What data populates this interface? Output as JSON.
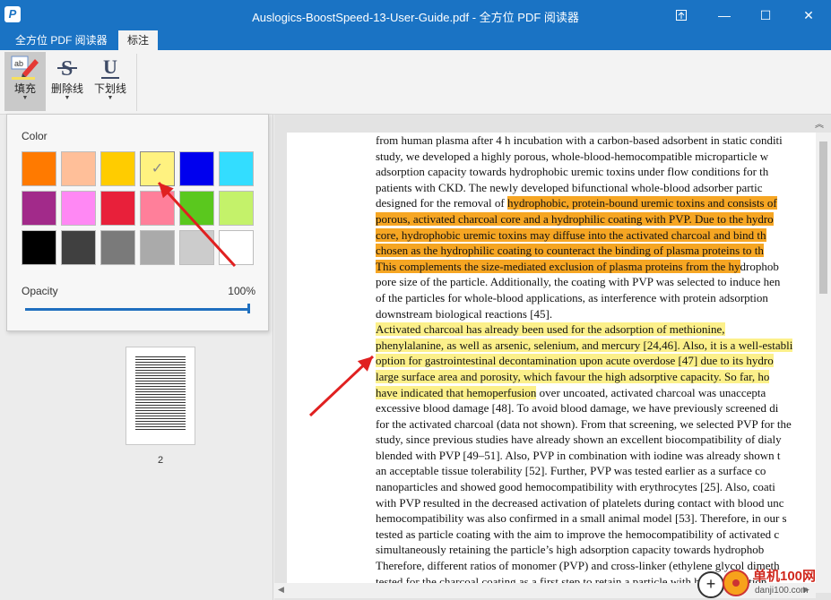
{
  "window": {
    "title": "Auslogics-BoostSpeed-13-User-Guide.pdf - 全方位 PDF 阅读器",
    "app_icon_glyph": "P",
    "controls": {
      "restore_down_icon": "restore-icon",
      "minimize": "—",
      "maximize": "☐",
      "close": "✕"
    }
  },
  "tabs": [
    {
      "label": "全方位 PDF 阅读器",
      "active": false
    },
    {
      "label": "标注",
      "active": true
    }
  ],
  "ribbon": {
    "buttons": [
      {
        "label": "填充",
        "icon": "highlight-fill-icon",
        "active": true
      },
      {
        "label": "删除线",
        "icon": "strikethrough-icon",
        "active": false
      },
      {
        "label": "下划线",
        "icon": "underline-icon",
        "active": false
      }
    ]
  },
  "color_popup": {
    "title": "Color",
    "swatches": [
      [
        "#ff7a00",
        "#ffbf99",
        "#ffcc00",
        "#fff280",
        "#0000ee",
        "#33ddff"
      ],
      [
        "#a22a8a",
        "#ff88f4",
        "#e8203a",
        "#ff7f9a",
        "#5ac81e",
        "#c4f26a"
      ],
      [
        "#000000",
        "#404040",
        "#7a7a7a",
        "#aaaaaa",
        "#cccccc",
        "#ffffff"
      ]
    ],
    "selected": {
      "row": 0,
      "col": 3
    },
    "check_glyph": "✓",
    "opacity_label": "Opacity",
    "opacity_value": "100%",
    "opacity_fraction": 1.0
  },
  "thumbnail": {
    "page_number": "2"
  },
  "document": {
    "lines": [
      {
        "segments": [
          [
            "from human plasma after 4 h incubation with a carbon-based adsorbent in static conditi",
            ""
          ]
        ]
      },
      {
        "segments": [
          [
            "study, we developed a highly porous, whole-blood-hemocompatible microparticle w",
            ""
          ]
        ]
      },
      {
        "segments": [
          [
            "adsorption capacity towards hydrophobic uremic toxins under flow conditions for th",
            ""
          ]
        ]
      },
      {
        "segments": [
          [
            "patients with CKD. The newly developed bifunctional whole-blood adsorber partic",
            ""
          ]
        ]
      },
      {
        "segments": [
          [
            "designed for the removal of ",
            ""
          ],
          [
            " hydrophobic, protein-bound uremic toxins and consists of",
            "orange"
          ]
        ]
      },
      {
        "segments": [
          [
            "porous, activated charcoal core and a hydrophilic coating with PVP. Due to the hydro",
            "orange"
          ]
        ]
      },
      {
        "segments": [
          [
            "core, hydrophobic uremic toxins may diffuse into the activated charcoal and bind th",
            "orange"
          ]
        ]
      },
      {
        "segments": [
          [
            "chosen as the hydrophilic coating to counteract the binding of plasma proteins to th",
            "orange"
          ]
        ]
      },
      {
        "segments": [
          [
            "This complements the size-mediated exclusion of plasma proteins from the hy",
            "orange"
          ],
          [
            "drophob",
            ""
          ]
        ]
      },
      {
        "segments": [
          [
            "pore size of the particle. Additionally, the coating with PVP was selected to induce hen",
            ""
          ]
        ]
      },
      {
        "segments": [
          [
            "of the particles for whole-blood applications, as interference with protein adsorption",
            ""
          ]
        ]
      },
      {
        "segments": [
          [
            "downstream biological reactions [45].",
            ""
          ]
        ]
      },
      {
        "segments": [
          [
            "        ",
            ""
          ],
          [
            "Activated charcoal has already been used for the adsorption of methionine,",
            "yellow"
          ]
        ]
      },
      {
        "segments": [
          [
            "phenylalanine, as well as arsenic, selenium, and mercury [24,46]. Also, it is a well-establi",
            "yellow"
          ]
        ]
      },
      {
        "segments": [
          [
            "option for gastrointestinal decontamination upon acute overdose [47] due to its hydro",
            "yellow"
          ]
        ]
      },
      {
        "segments": [
          [
            "large surface area and porosity, which favour the high adsorptive capacity. So far, ho",
            "yellow"
          ]
        ]
      },
      {
        "segments": [
          [
            "have indicated that hemoperfusion",
            "yellow"
          ],
          [
            " over uncoated, activated charcoal was unaccepta",
            ""
          ]
        ]
      },
      {
        "segments": [
          [
            "excessive blood damage [48]. To avoid blood damage, we have previously screened di",
            ""
          ]
        ]
      },
      {
        "segments": [
          [
            "for the activated charcoal (data not shown). From that screening, we selected PVP for the",
            ""
          ]
        ]
      },
      {
        "segments": [
          [
            "study, since previous studies have already shown an excellent biocompatibility of dialy",
            ""
          ]
        ]
      },
      {
        "segments": [
          [
            "blended with PVP [49–51]. Also, PVP in combination with iodine was already shown t",
            ""
          ]
        ]
      },
      {
        "segments": [
          [
            "an acceptable tissue tolerability [52]. Further, PVP was tested earlier as a surface co",
            ""
          ]
        ]
      },
      {
        "segments": [
          [
            "nanoparticles and showed good hemocompatibility with erythrocytes [25]. Also, coati",
            ""
          ]
        ]
      },
      {
        "segments": [
          [
            "with PVP resulted in the decreased activation of platelets during contact with blood unc",
            ""
          ]
        ]
      },
      {
        "segments": [
          [
            "hemocompatibility was also confirmed in a small animal model [53]. Therefore, in our s",
            ""
          ]
        ]
      },
      {
        "segments": [
          [
            "tested as particle coating with the aim to improve the hemocompatibility of activated c",
            ""
          ]
        ]
      },
      {
        "segments": [
          [
            "simultaneously retaining the particle’s high adsorption capacity towards hydrophob",
            ""
          ]
        ]
      },
      {
        "segments": [
          [
            "Therefore, different ratios of monomer (PVP) and cross-linker (ethylene glycol dimeth",
            ""
          ]
        ]
      },
      {
        "segments": [
          [
            "tested for the charcoal coating as a first step to retain a particle with high adsorption",
            ""
          ]
        ]
      }
    ]
  },
  "fab": {
    "glyph": "+"
  },
  "watermark": {
    "title": "单机100网",
    "url": "danji100.com"
  },
  "annotations": {
    "arrow_color": "#e02020"
  }
}
